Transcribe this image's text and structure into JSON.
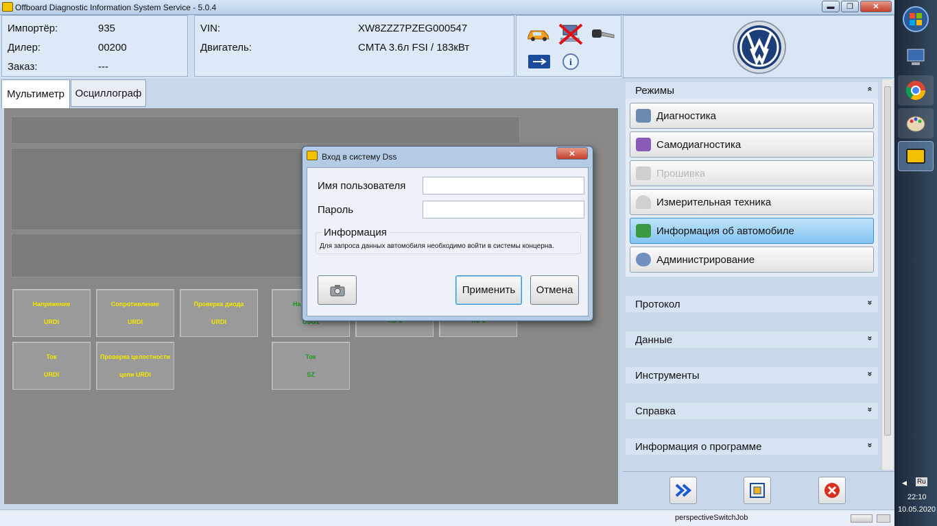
{
  "window": {
    "title": "Offboard Diagnostic Information System Service - 5.0.4",
    "minimize": "▬",
    "maximize": "❐",
    "close": "✕"
  },
  "header": {
    "importer_label": "Импортёр:",
    "importer_value": "935",
    "dealer_label": "Дилер:",
    "dealer_value": "00200",
    "order_label": "Заказ:",
    "order_value": "---",
    "vin_label": "VIN:",
    "vin_value": "XW8ZZZ7PZEG000547",
    "engine_label": "Двигатель:",
    "engine_value": "CMTA 3.6л FSI / 183кВт",
    "icons": [
      "car-icon",
      "network-disconnected-icon",
      "key-icon",
      "usb-icon",
      "info-icon"
    ]
  },
  "tabs": [
    {
      "label": "Мультиметр",
      "active": true
    },
    {
      "label": "Осциллограф",
      "active": false
    }
  ],
  "tiles": [
    {
      "top": "Напряжение",
      "bottom": "URDI",
      "color": "yellow"
    },
    {
      "top": "Сопротивление",
      "bottom": "URDI",
      "color": "yellow"
    },
    {
      "top": "Проверка диода",
      "bottom": "URDI",
      "color": "yellow"
    },
    {
      "top": "На",
      "bottom": "DSO1",
      "color": "green"
    },
    {
      "top": "",
      "bottom": "T/D-1",
      "color": "green"
    },
    {
      "top": "",
      "bottom": "T/D-2",
      "color": "green"
    },
    {
      "top": "Ток",
      "bottom": "URDI",
      "color": "yellow"
    },
    {
      "top": "Проверка целостности",
      "bottom": "цепи URDI",
      "color": "yellow"
    },
    {
      "top": "Ток",
      "bottom": "SZ",
      "color": "green"
    }
  ],
  "dialog": {
    "title": "Вход в систему Dss",
    "username_label": "Имя пользователя",
    "username_value": "",
    "password_label": "Пароль",
    "password_value": "",
    "info_group": "Информация",
    "info_text": "Для запроса данных автомобиля необходимо войти в системы концерна.",
    "apply_label": "Применить",
    "cancel_label": "Отмена",
    "close": "✕"
  },
  "sidebar": {
    "modes_title": "Режимы",
    "modes": [
      {
        "label": "Диагностика",
        "state": "normal",
        "icon_color": "#6a8ab0"
      },
      {
        "label": "Самодиагностика",
        "state": "normal",
        "icon_color": "#8a5ab8"
      },
      {
        "label": "Прошивка",
        "state": "disabled",
        "icon_color": "#cfcfcf"
      },
      {
        "label": "Измерительная техника",
        "state": "normal",
        "icon_color": "#d0d0d0"
      },
      {
        "label": "Информация об автомобиле",
        "state": "active",
        "icon_color": "#3a9a40"
      },
      {
        "label": "Администрирование",
        "state": "normal",
        "icon_color": "#7090c0"
      }
    ],
    "sections": [
      "Протокол",
      "Данные",
      "Инструменты",
      "Справка",
      "Информация о программе"
    ],
    "expand_glyph": "»",
    "collapse_glyph": "«"
  },
  "status": {
    "text": "perspectiveSwitchJob"
  },
  "taskbar": {
    "lang": "Ru",
    "time": "22:10",
    "date": "10.05.2020"
  },
  "colors": {
    "accent": "#84c4f0",
    "tile_yellow": "#f5e800",
    "tile_green": "#1a9a1a",
    "close_red": "#d8301c"
  }
}
